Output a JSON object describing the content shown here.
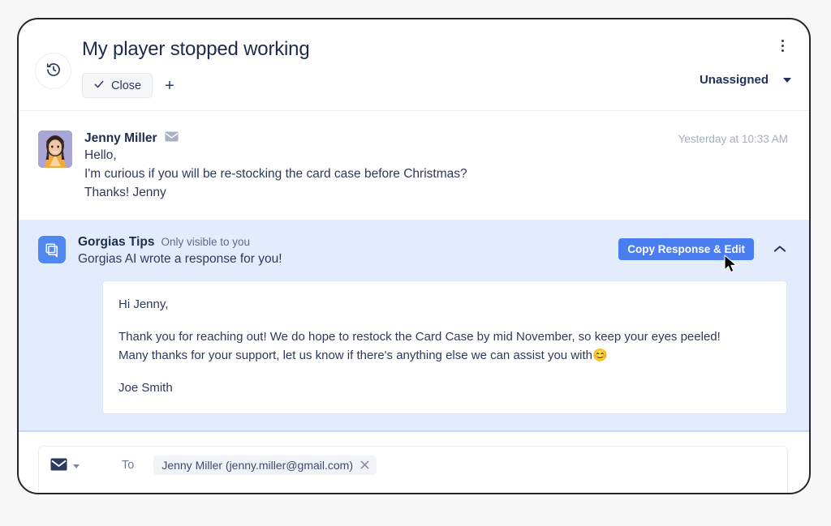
{
  "header": {
    "title": "My player stopped working",
    "history_icon": "history-clock-icon",
    "close_label": "Close",
    "add_label": "+",
    "kebab_icon": "more-options-icon",
    "assignee": "Unassigned"
  },
  "message": {
    "avatar_alt": "Jenny Miller avatar",
    "sender": "Jenny Miller",
    "channel_icon": "envelope-icon",
    "timestamp": "Yesterday at 10:33 AM",
    "lines": [
      "Hello,",
      "I'm curious if you will be re-stocking the card case before Christmas?",
      "Thanks! Jenny"
    ]
  },
  "tips": {
    "icon": "copy-duplicate-icon",
    "title": "Gorgias Tips",
    "visibility": "Only visible to you",
    "description": "Gorgias AI wrote a response for you!",
    "copy_button": "Copy Response & Edit",
    "collapse_icon": "chevron-up-icon",
    "response": {
      "greeting": "Hi Jenny,",
      "body_line_1": "Thank you for reaching out! We do hope to restock the Card Case by mid November, so keep your eyes peeled!",
      "body_line_2": "Many thanks for your support, let us know if there's anything else we can assist you with😊",
      "signature": "Joe Smith"
    }
  },
  "composer": {
    "channel_icon": "envelope-icon",
    "to_label": "To",
    "recipient": "Jenny Miller (jenny.miller@gmail.com)",
    "remove_icon": "close-x-icon"
  },
  "colors": {
    "accent_blue": "#4a7df0",
    "tips_panel_bg": "#e3ecfd",
    "text_dark": "#1d2b4d",
    "text_muted": "#a7adc2",
    "page_bg": "#f7f7f8"
  }
}
